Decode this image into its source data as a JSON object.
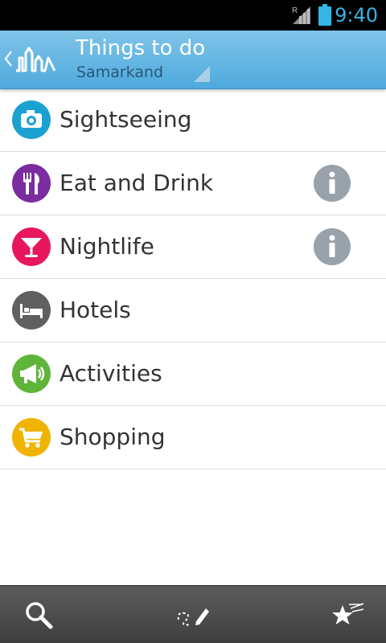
{
  "status_bar": {
    "time": "9:40",
    "roaming_indicator": "R",
    "time_color": "#33b5e5",
    "icons": [
      "signal-icon",
      "battery-icon"
    ]
  },
  "action_bar": {
    "title": "Things to do",
    "subtitle": "Samarkand",
    "background": "#5fb2e0",
    "icons": [
      "back-chevron-icon",
      "app-logo-icon",
      "spinner-triangle-icon"
    ]
  },
  "categories": [
    {
      "label": "Sightseeing",
      "icon": "camera-icon",
      "color": "#1ba1d0",
      "has_info": false
    },
    {
      "label": "Eat and Drink",
      "icon": "fork-knife-icon",
      "color": "#7b2ca0",
      "has_info": true
    },
    {
      "label": "Nightlife",
      "icon": "cocktail-icon",
      "color": "#e8175d",
      "has_info": true
    },
    {
      "label": "Hotels",
      "icon": "bed-icon",
      "color": "#606060",
      "has_info": false
    },
    {
      "label": "Activities",
      "icon": "megaphone-icon",
      "color": "#5fb43a",
      "has_info": false
    },
    {
      "label": "Shopping",
      "icon": "cart-icon",
      "color": "#f0b400",
      "has_info": false
    }
  ],
  "info_icon": {
    "icon": "info-icon",
    "color": "#97a2ab"
  },
  "bottom_bar": {
    "buttons": [
      {
        "icon": "search-icon"
      },
      {
        "icon": "draw-route-icon"
      },
      {
        "icon": "favorites-stars-icon"
      }
    ]
  }
}
